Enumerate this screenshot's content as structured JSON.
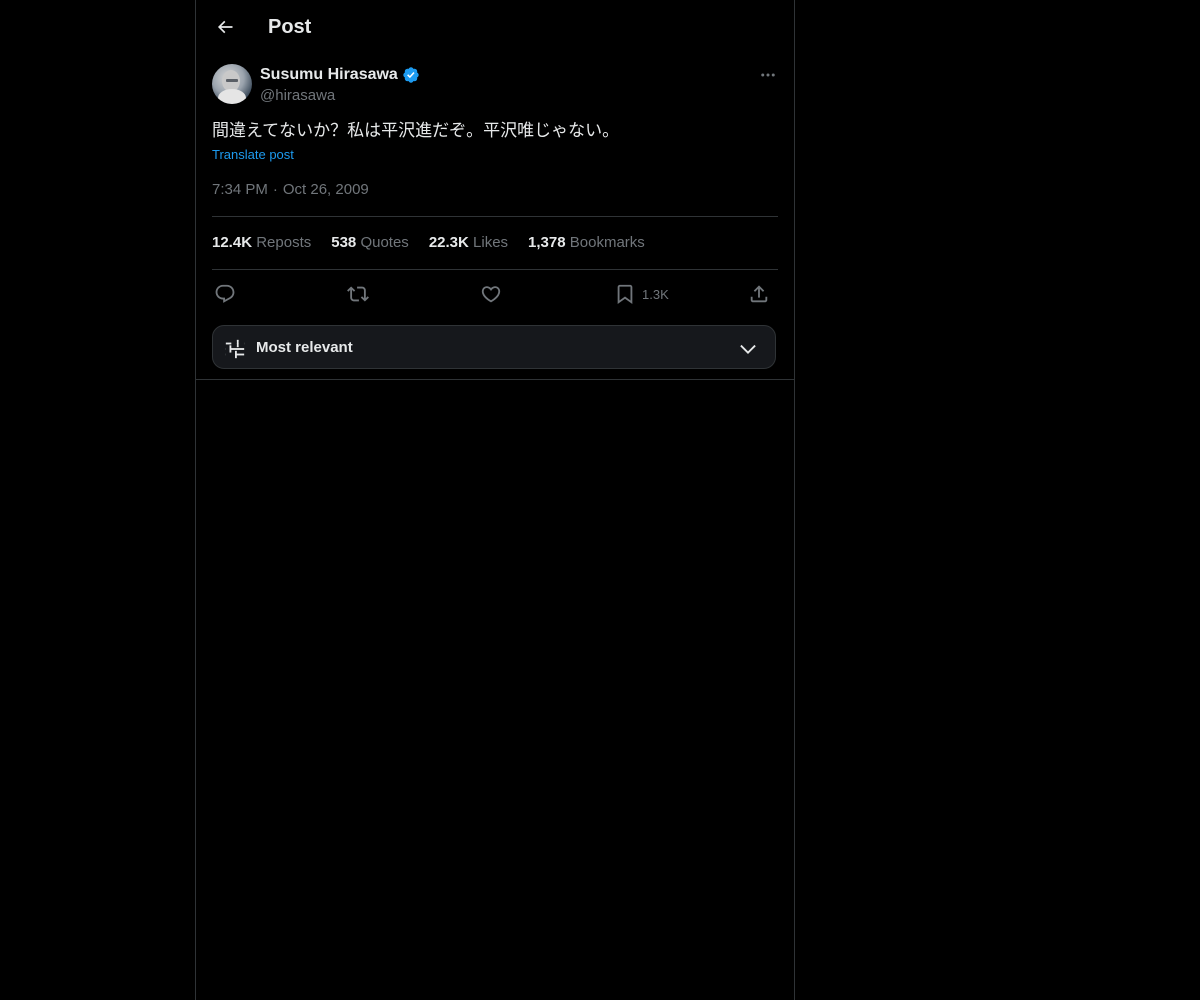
{
  "header": {
    "title": "Post"
  },
  "author": {
    "name": "Susumu Hirasawa",
    "handle": "@hirasawa",
    "verified": true
  },
  "post": {
    "text": "間違えてないか？私は平沢進だぞ。平沢唯じゃない。",
    "translate_label": "Translate post",
    "time": "7:34 PM",
    "date": "Oct 26, 2009"
  },
  "stats": {
    "reposts": {
      "count": "12.4K",
      "label": "Reposts"
    },
    "quotes": {
      "count": "538",
      "label": "Quotes"
    },
    "likes": {
      "count": "22.3K",
      "label": "Likes"
    },
    "bookmarks": {
      "count": "1,378",
      "label": "Bookmarks"
    }
  },
  "actions": {
    "reply_icon": "reply-icon",
    "repost_icon": "repost-icon",
    "like_icon": "heart-icon",
    "bookmark_icon": "bookmark-icon",
    "bookmark_count": "1.3K",
    "share_icon": "share-icon"
  },
  "sort": {
    "label": "Most relevant"
  },
  "colors": {
    "background": "#000000",
    "text_primary": "#e7e9ea",
    "text_secondary": "#71767b",
    "accent": "#1d9bf0",
    "border": "#2f3336"
  }
}
